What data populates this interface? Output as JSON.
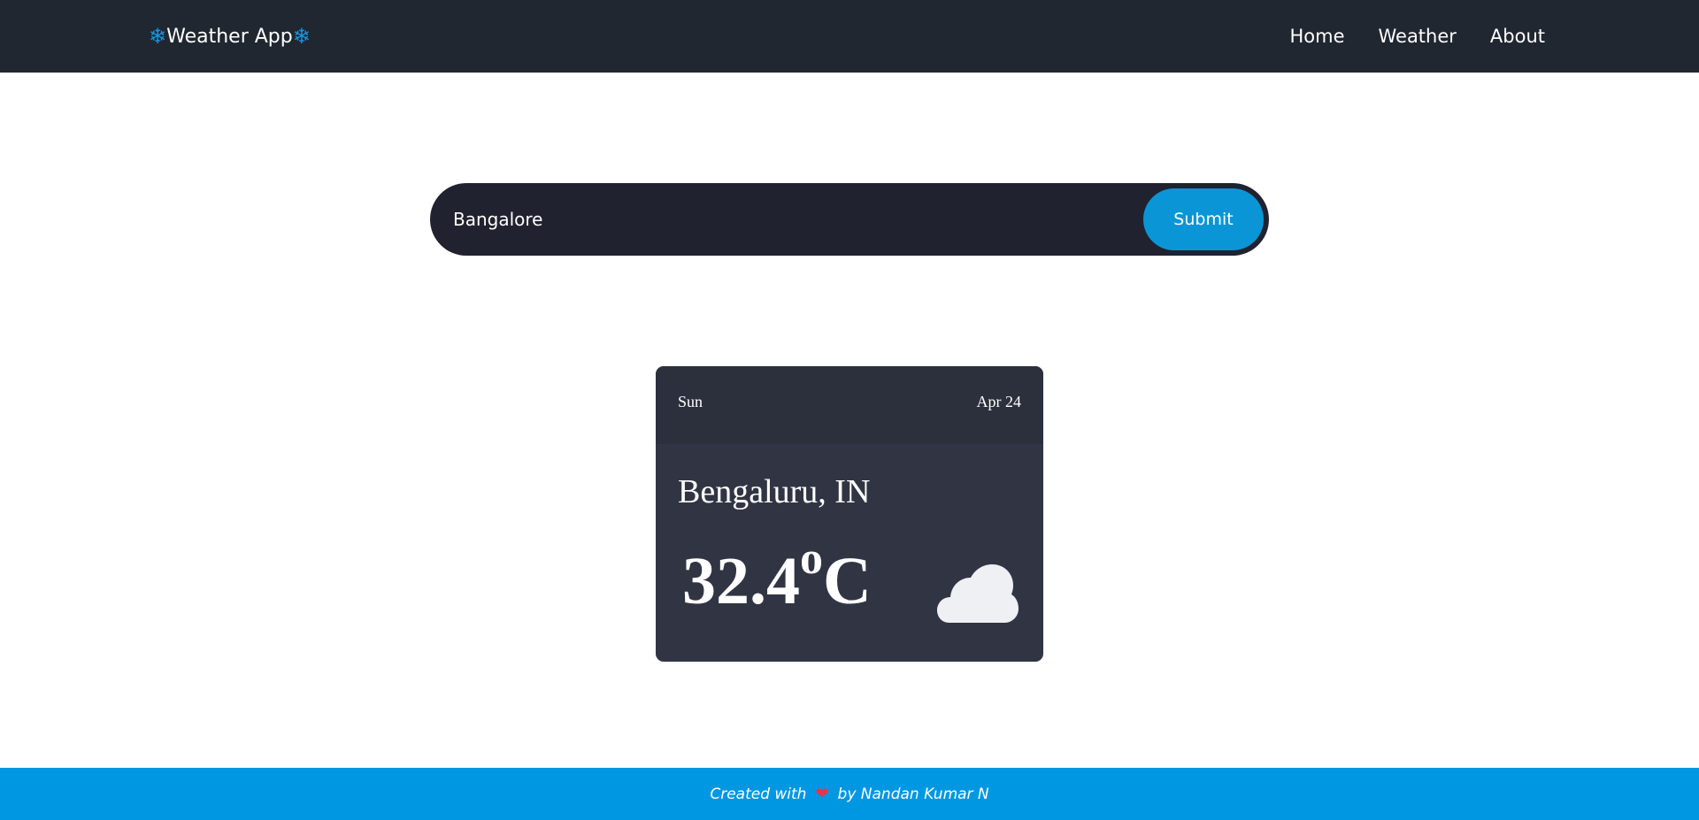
{
  "navbar": {
    "brand_text": "Weather App",
    "brand_icon_glyph": "❄",
    "links": [
      {
        "label": "Home"
      },
      {
        "label": "Weather"
      },
      {
        "label": "About"
      }
    ]
  },
  "search": {
    "value": "Bangalore",
    "submit_label": "Submit"
  },
  "weather": {
    "day": "Sun",
    "date": "Apr 24",
    "location": "Bengaluru, IN",
    "temperature": "32.4",
    "degree_symbol": "o",
    "unit": "C",
    "condition_icon": "cloud-icon"
  },
  "footer": {
    "text_before": "Created with",
    "heart_glyph": "❤",
    "text_after": "by Nandan Kumar N"
  },
  "colors": {
    "navbar_bg": "#212731",
    "accent": "#0a96d6",
    "card_bg": "#313543",
    "footer_bg": "#0097e2",
    "heart": "#f0314a"
  }
}
